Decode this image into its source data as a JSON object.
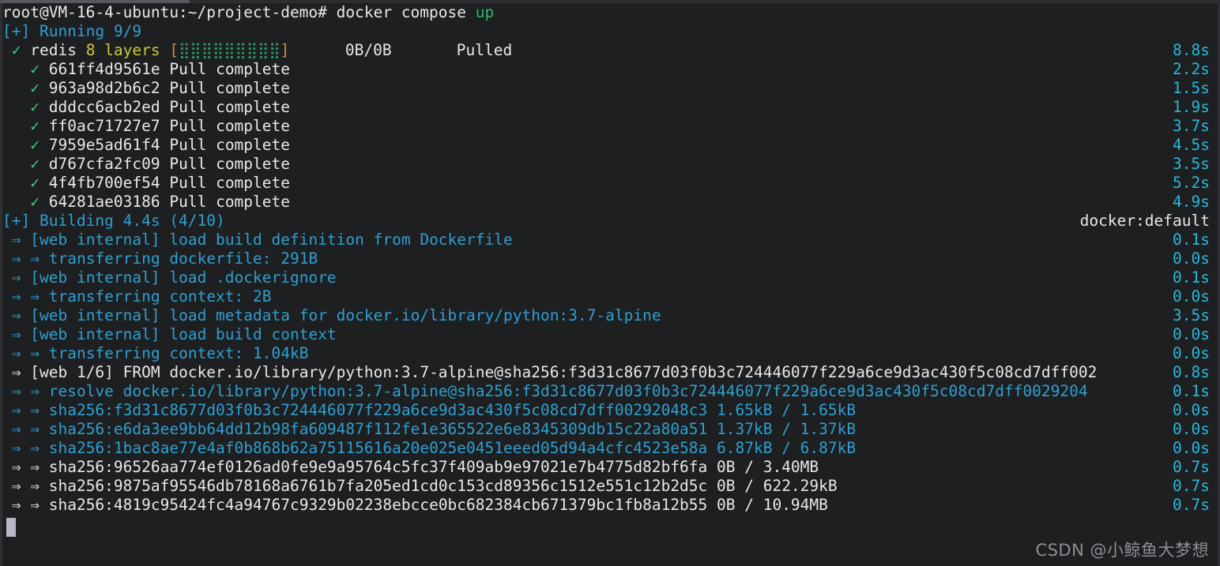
{
  "terminal": {
    "background": "#1d1f21",
    "foreground": "#e8e8e8",
    "cursor_color": "#b6b8c4",
    "colors": {
      "cyan": "#2f9fd0",
      "bright_cyan": "#29b8db",
      "green": "#35b46a",
      "yellow": "#cbc93b",
      "white": "#e8e8e8",
      "orange_bracket": "#c98a4b"
    }
  },
  "prompt": {
    "user_host_path": "root@VM-16-4-ubuntu:~/project-demo# docker compose ",
    "command_tail": "up"
  },
  "running": {
    "header": "[+] Running 9/9",
    "service": {
      "check": "✓",
      "name": "redis",
      "layers": "8 layers",
      "bar_open": "[",
      "bar_fill": "⣿⣿⣿⣿⣿⣿⣿⣿⣿",
      "bar_close": "]",
      "size": "0B/0B",
      "status": "Pulled",
      "time": "8.8s"
    },
    "layers": [
      {
        "check": "✓",
        "id": "661ff4d9561e",
        "status": "Pull complete",
        "time": "2.2s"
      },
      {
        "check": "✓",
        "id": "963a98d2b6c2",
        "status": "Pull complete",
        "time": "1.5s"
      },
      {
        "check": "✓",
        "id": "dddcc6acb2ed",
        "status": "Pull complete",
        "time": "1.9s"
      },
      {
        "check": "✓",
        "id": "ff0ac71727e7",
        "status": "Pull complete",
        "time": "3.7s"
      },
      {
        "check": "✓",
        "id": "7959e5ad61f4",
        "status": "Pull complete",
        "time": "4.5s"
      },
      {
        "check": "✓",
        "id": "d767cfa2fc09",
        "status": "Pull complete",
        "time": "3.5s"
      },
      {
        "check": "✓",
        "id": "4f4fb700ef54",
        "status": "Pull complete",
        "time": "5.2s"
      },
      {
        "check": "✓",
        "id": "64281ae03186",
        "status": "Pull complete",
        "time": "4.9s"
      }
    ]
  },
  "building": {
    "header": "[+] Building 4.4s (4/10)",
    "builder": "docker:default",
    "steps": [
      {
        "arrow": "⇒",
        "text": "[web internal] load build definition from Dockerfile",
        "time": "0.1s",
        "color": "cyan",
        "indent": 1
      },
      {
        "arrow": "⇒ ⇒",
        "text": "transferring dockerfile: 291B",
        "time": "0.0s",
        "color": "cyan",
        "indent": 1
      },
      {
        "arrow": "⇒",
        "text": "[web internal] load .dockerignore",
        "time": "0.1s",
        "color": "cyan",
        "indent": 1
      },
      {
        "arrow": "⇒ ⇒",
        "text": "transferring context: 2B",
        "time": "0.0s",
        "color": "cyan",
        "indent": 1
      },
      {
        "arrow": "⇒",
        "text": "[web internal] load metadata for docker.io/library/python:3.7-alpine",
        "time": "3.5s",
        "color": "cyan",
        "indent": 1
      },
      {
        "arrow": "⇒",
        "text": "[web internal] load build context",
        "time": "0.0s",
        "color": "cyan",
        "indent": 1
      },
      {
        "arrow": "⇒ ⇒",
        "text": "transferring context: 1.04kB",
        "time": "0.0s",
        "color": "cyan",
        "indent": 1
      },
      {
        "arrow": "⇒",
        "text": "[web 1/6] FROM docker.io/library/python:3.7-alpine@sha256:f3d31c8677d03f0b3c724446077f229a6ce9d3ac430f5c08cd7dff002",
        "time": "0.8s",
        "color": "white",
        "indent": 1
      },
      {
        "arrow": "⇒ ⇒",
        "text": "resolve docker.io/library/python:3.7-alpine@sha256:f3d31c8677d03f0b3c724446077f229a6ce9d3ac430f5c08cd7dff0029204",
        "time": "0.1s",
        "color": "cyan",
        "indent": 1
      },
      {
        "arrow": "⇒ ⇒",
        "text": "sha256:f3d31c8677d03f0b3c724446077f229a6ce9d3ac430f5c08cd7dff00292048c3 1.65kB / 1.65kB",
        "time": "0.0s",
        "color": "cyan",
        "indent": 1
      },
      {
        "arrow": "⇒ ⇒",
        "text": "sha256:e6da3ee9bb64dd12b98fa609487f112fe1e365522e6e8345309db15c22a80a51 1.37kB / 1.37kB",
        "time": "0.0s",
        "color": "cyan",
        "indent": 1
      },
      {
        "arrow": "⇒ ⇒",
        "text": "sha256:1bac8ae77e4af0b868b62a75115616a20e025e0451eeed05d94a4cfc4523e58a 6.87kB / 6.87kB",
        "time": "0.0s",
        "color": "cyan",
        "indent": 1
      },
      {
        "arrow": "⇒ ⇒",
        "text": "sha256:96526aa774ef0126ad0fe9e9a95764c5fc37f409ab9e97021e7b4775d82bf6fa 0B / 3.40MB",
        "time": "0.7s",
        "color": "white",
        "indent": 1
      },
      {
        "arrow": "⇒ ⇒",
        "text": "sha256:9875af95546db78168a6761b7fa205ed1cd0c153cd89356c1512e551c12b2d5c 0B / 622.29kB",
        "time": "0.7s",
        "color": "white",
        "indent": 1
      },
      {
        "arrow": "⇒ ⇒",
        "text": "sha256:4819c95424fc4a94767c9329b02238ebcce0bc682384cb671379bc1fb8a12b55 0B / 10.94MB",
        "time": "0.7s",
        "color": "white",
        "indent": 1
      }
    ]
  },
  "watermark": "CSDN @小鲸鱼大梦想"
}
